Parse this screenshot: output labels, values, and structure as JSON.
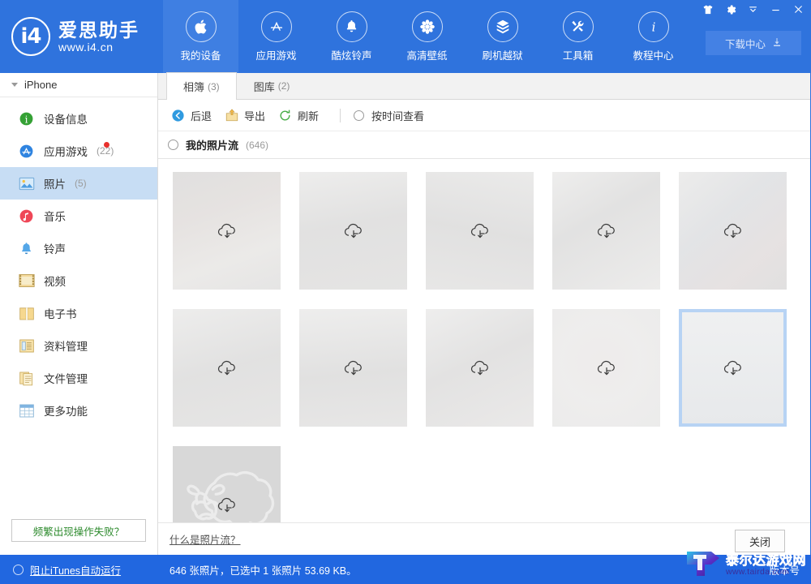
{
  "window": {
    "controls": [
      {
        "name": "skin-icon",
        "label": "皮肤"
      },
      {
        "name": "settings-gear-icon",
        "label": "设置"
      },
      {
        "name": "minimize-to-tray-icon",
        "label": "收起"
      },
      {
        "name": "minimize-icon",
        "label": "最小化"
      },
      {
        "name": "close-icon",
        "label": "关闭"
      }
    ]
  },
  "brand": {
    "logo_text": "i4",
    "name": "爱思助手",
    "url": "www.i4.cn"
  },
  "topnav": {
    "items": [
      {
        "label": "我的设备",
        "icon": "apple-icon",
        "active": true
      },
      {
        "label": "应用游戏",
        "icon": "appstore-icon",
        "active": false
      },
      {
        "label": "酷炫铃声",
        "icon": "bell-icon",
        "active": false
      },
      {
        "label": "高清壁纸",
        "icon": "flower-icon",
        "active": false
      },
      {
        "label": "刷机越狱",
        "icon": "box-icon",
        "active": false
      },
      {
        "label": "工具箱",
        "icon": "tools-icon",
        "active": false
      },
      {
        "label": "教程中心",
        "icon": "info-icon",
        "active": false
      }
    ],
    "download_center": "下载中心"
  },
  "sidebar": {
    "device": "iPhone",
    "items": [
      {
        "label": "设备信息",
        "count": "",
        "icon": "info-circle-icon",
        "active": false,
        "badge": false
      },
      {
        "label": "应用游戏",
        "count": "(22)",
        "icon": "appstore-circle-icon",
        "active": false,
        "badge": true
      },
      {
        "label": "照片",
        "count": "(5)",
        "icon": "photo-icon",
        "active": true,
        "badge": false
      },
      {
        "label": "音乐",
        "count": "",
        "icon": "music-icon",
        "active": false,
        "badge": false
      },
      {
        "label": "铃声",
        "count": "",
        "icon": "ringtone-bell-icon",
        "active": false,
        "badge": false
      },
      {
        "label": "视频",
        "count": "",
        "icon": "video-film-icon",
        "active": false,
        "badge": false
      },
      {
        "label": "电子书",
        "count": "",
        "icon": "book-icon",
        "active": false,
        "badge": false
      },
      {
        "label": "资料管理",
        "count": "",
        "icon": "data-folder-icon",
        "active": false,
        "badge": false
      },
      {
        "label": "文件管理",
        "count": "",
        "icon": "file-manager-icon",
        "active": false,
        "badge": false
      },
      {
        "label": "更多功能",
        "count": "",
        "icon": "grid-more-icon",
        "active": false,
        "badge": false
      }
    ],
    "trouble_button": "频繁出现操作失败？"
  },
  "content": {
    "tabs": [
      {
        "label": "相簿",
        "count": "(3)",
        "active": true
      },
      {
        "label": "图库",
        "count": "(2)",
        "active": false
      }
    ],
    "toolbar": [
      {
        "label": "后退",
        "icon": "back-arrow-icon"
      },
      {
        "label": "导出",
        "icon": "export-icon"
      },
      {
        "label": "刷新",
        "icon": "refresh-icon"
      }
    ],
    "view_by_time": "按时间查看",
    "stream": {
      "title": "我的照片流",
      "count": "(646)"
    },
    "thumbnails": [
      {
        "id": 1,
        "selected": false,
        "icon": "cloud-download-icon"
      },
      {
        "id": 2,
        "selected": false,
        "icon": "cloud-download-icon"
      },
      {
        "id": 3,
        "selected": false,
        "icon": "cloud-download-icon"
      },
      {
        "id": 4,
        "selected": false,
        "icon": "cloud-download-icon"
      },
      {
        "id": 5,
        "selected": false,
        "icon": "cloud-download-icon"
      },
      {
        "id": 6,
        "selected": false,
        "icon": "cloud-download-icon"
      },
      {
        "id": 7,
        "selected": false,
        "icon": "cloud-download-icon"
      },
      {
        "id": 8,
        "selected": false,
        "icon": "cloud-download-icon"
      },
      {
        "id": 9,
        "selected": false,
        "icon": "cloud-download-icon"
      },
      {
        "id": 10,
        "selected": true,
        "icon": "cloud-download-icon"
      },
      {
        "id": 11,
        "selected": false,
        "icon": "cloud-download-icon"
      }
    ],
    "what_is_stream": "什么是照片流？",
    "close_button": "关闭"
  },
  "statusbar": {
    "block_itunes": "阻止iTunes自动运行",
    "info": "646 张照片，已选中 1 张照片 53.69 KB。",
    "version": "版本号"
  },
  "watermark": {
    "title": "泰尔达游戏网",
    "url": "www.tairda.com"
  },
  "colors": {
    "brand_blue": "#2f73dd",
    "status_blue": "#2167e0",
    "selected_side": "#c7ddf4",
    "selected_thumb_border": "#b7d3f4",
    "badge_red": "#e8302d",
    "trouble_green": "#2e8b2e"
  }
}
